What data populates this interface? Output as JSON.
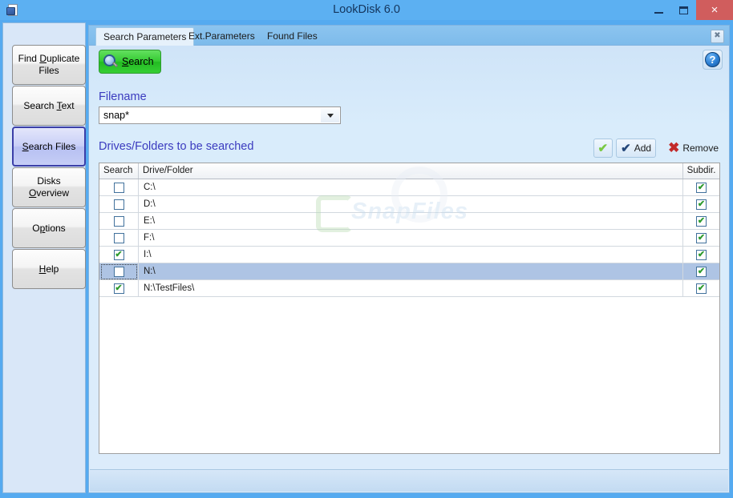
{
  "window": {
    "title": "LookDisk 6.0",
    "icon": "disk-document-icon",
    "controls": {
      "minimize": "minimize-icon",
      "maximize": "maximize-icon",
      "close": "×"
    }
  },
  "sidebar": {
    "items": [
      {
        "label": "Find Duplicate Files",
        "pre": "Find ",
        "accel": "D",
        "post": "uplicate Files",
        "active": false
      },
      {
        "label": "Search Text",
        "pre": "Search ",
        "accel": "T",
        "post": "ext",
        "active": false
      },
      {
        "label": "Search Files",
        "pre": "",
        "accel": "S",
        "post": "earch Files",
        "active": true
      },
      {
        "label": "Disks Overview",
        "pre": "Disks ",
        "accel": "O",
        "post": "verview",
        "active": false
      },
      {
        "label": "Options",
        "pre": "O",
        "accel": "p",
        "post": "tions",
        "active": false
      },
      {
        "label": "Help",
        "pre": "",
        "accel": "H",
        "post": "elp",
        "active": false
      }
    ]
  },
  "tabs": {
    "items": [
      {
        "label": "Search Parameters",
        "active": true
      },
      {
        "label": "Ext.Parameters",
        "active": false
      },
      {
        "label": "Found Files",
        "active": false
      }
    ],
    "close_label": "✖"
  },
  "toolbar": {
    "search_button": {
      "pre": "",
      "accel": "S",
      "post": "earch",
      "icon": "magnifier-icon"
    },
    "help_button": {
      "label": "?",
      "icon": "help-circle-icon"
    }
  },
  "filename": {
    "label": "Filename",
    "value": "snap*",
    "placeholder": ""
  },
  "drives_section": {
    "title": "Drives/Folders to be searched",
    "buttons": [
      {
        "name": "check-all-button",
        "label": "",
        "icon": "green-check-icon"
      },
      {
        "name": "add-button",
        "label": "Add",
        "icon": "check-icon"
      },
      {
        "name": "remove-button",
        "label": "Remove",
        "icon": "red-x-icon"
      }
    ]
  },
  "grid": {
    "columns": [
      "Search",
      "Drive/Folder",
      "Subdir."
    ],
    "rows": [
      {
        "search": false,
        "path": "C:\\",
        "subdir": true,
        "selected": false
      },
      {
        "search": false,
        "path": "D:\\",
        "subdir": true,
        "selected": false
      },
      {
        "search": false,
        "path": "E:\\",
        "subdir": true,
        "selected": false
      },
      {
        "search": false,
        "path": "F:\\",
        "subdir": true,
        "selected": false
      },
      {
        "search": true,
        "path": "I:\\",
        "subdir": true,
        "selected": false
      },
      {
        "search": false,
        "path": "N:\\",
        "subdir": true,
        "selected": true
      },
      {
        "search": true,
        "path": "N:\\TestFiles\\",
        "subdir": true,
        "selected": false
      }
    ],
    "check_glyph": "✔"
  },
  "watermark": {
    "text": "SnapFiles"
  },
  "colors": {
    "titlebar": "#5cb0f2",
    "close_button": "#d05d5d",
    "search_green": "#35cb33",
    "label_blue": "#3b3bbf",
    "selected_row": "#aec4e4",
    "active_side_border": "#3b3fa8"
  }
}
